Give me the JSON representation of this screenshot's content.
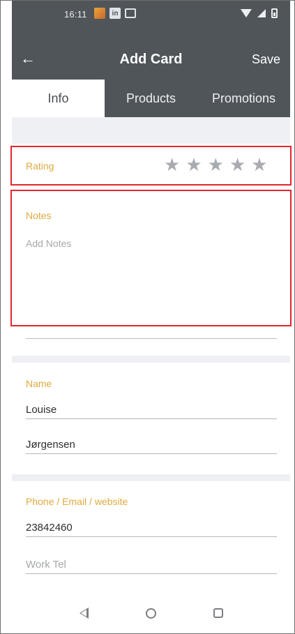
{
  "status_bar": {
    "time": "16:11",
    "icons_left": [
      "gallery-icon",
      "linkedin-icon",
      "message-icon"
    ],
    "icons_right": [
      "wifi-icon",
      "signal-icon",
      "battery-icon"
    ]
  },
  "app_bar": {
    "back_icon": "arrow-left-icon",
    "back_glyph": "←",
    "title": "Add Card",
    "save_label": "Save"
  },
  "tabs": [
    {
      "label": "Info",
      "active": true
    },
    {
      "label": "Products",
      "active": false
    },
    {
      "label": "Promotions",
      "active": false
    }
  ],
  "rating": {
    "label": "Rating",
    "star_glyph": "★",
    "value": 0,
    "max": 5
  },
  "notes": {
    "label": "Notes",
    "placeholder": "Add Notes"
  },
  "name_section": {
    "label": "Name",
    "first_name": "Louise",
    "last_name": "Jørgensen"
  },
  "contact_section": {
    "label": "Phone / Email / website",
    "phone": "23842460",
    "work_tel_placeholder": "Work Tel"
  },
  "colors": {
    "toolbar": "#50555a",
    "accent_label": "#e0aa3e",
    "highlight": "#e3262f"
  }
}
